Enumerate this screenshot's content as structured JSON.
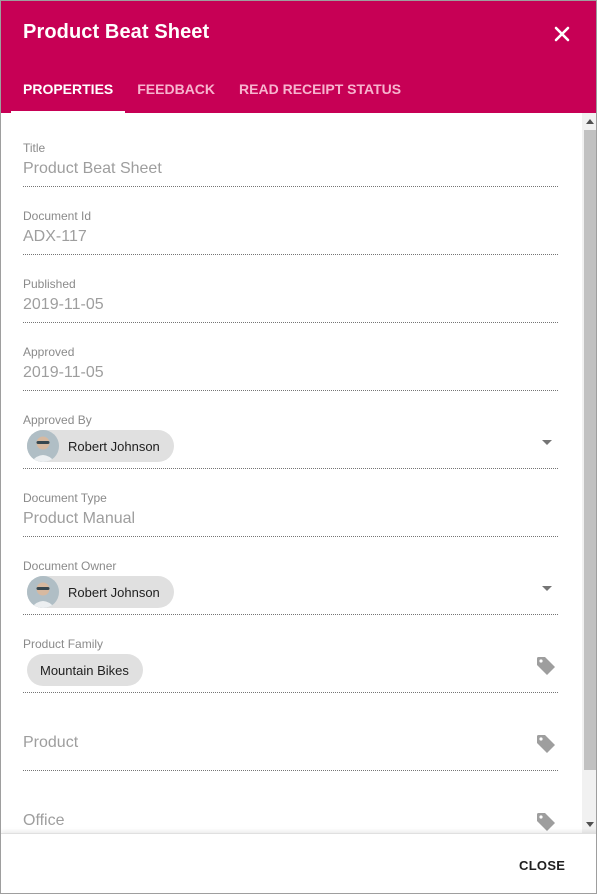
{
  "dialog": {
    "title": "Product Beat Sheet",
    "accent_color": "#c70055",
    "close_icon": "close-icon"
  },
  "tabs": [
    {
      "label": "Properties",
      "active": true
    },
    {
      "label": "Feedback",
      "active": false
    },
    {
      "label": "Read Receipt Status",
      "active": false
    }
  ],
  "fields": {
    "title": {
      "label": "Title",
      "value": "Product Beat Sheet"
    },
    "document_id": {
      "label": "Document Id",
      "value": "ADX-117"
    },
    "published": {
      "label": "Published",
      "value": "2019-11-05"
    },
    "approved": {
      "label": "Approved",
      "value": "2019-11-05"
    },
    "approved_by": {
      "label": "Approved By",
      "chip": "Robert Johnson",
      "icon": "chevron-down-icon"
    },
    "document_type": {
      "label": "Document Type",
      "value": "Product Manual"
    },
    "document_owner": {
      "label": "Document Owner",
      "chip": "Robert Johnson",
      "icon": "chevron-down-icon"
    },
    "product_family": {
      "label": "Product Family",
      "chip": "Mountain Bikes",
      "icon": "tag-icon"
    },
    "product": {
      "placeholder": "Product",
      "icon": "tag-icon"
    },
    "office": {
      "placeholder": "Office",
      "icon": "tag-icon"
    }
  },
  "footer": {
    "close_label": "Close"
  }
}
